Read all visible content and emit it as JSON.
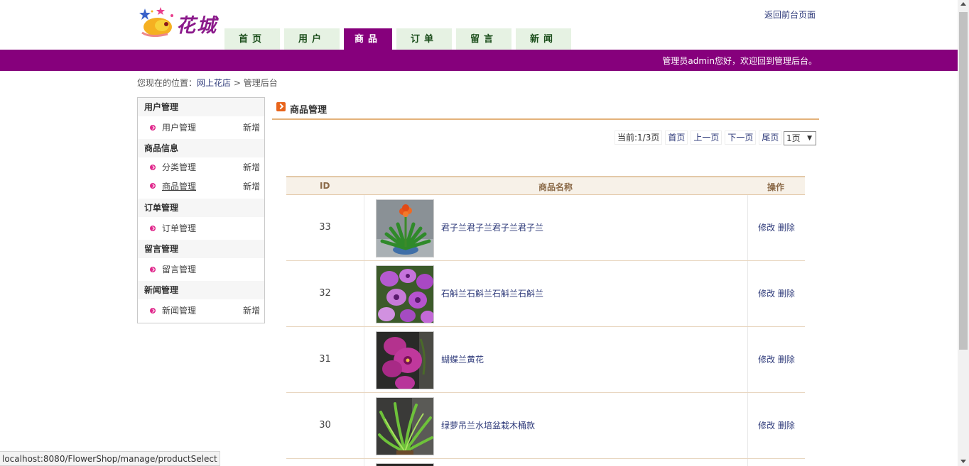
{
  "header": {
    "logo_text": "花城",
    "return_link": "返回前台页面",
    "nav": [
      {
        "label": "首页",
        "active": false
      },
      {
        "label": "用户",
        "active": false
      },
      {
        "label": "商品",
        "active": true
      },
      {
        "label": "订单",
        "active": false
      },
      {
        "label": "留言",
        "active": false
      },
      {
        "label": "新闻",
        "active": false
      }
    ],
    "welcome": "管理员admin您好，欢迎回到管理后台。"
  },
  "breadcrumb": {
    "prefix": "您现在的位置：",
    "link": "网上花店",
    "separator": ">",
    "current": "管理后台"
  },
  "sidebar": {
    "groups": [
      {
        "title": "用户管理",
        "items": [
          {
            "label": "用户管理",
            "add": "新增"
          }
        ]
      },
      {
        "title": "商品信息",
        "items": [
          {
            "label": "分类管理",
            "add": "新增"
          },
          {
            "label": "商品管理",
            "add": "新增"
          }
        ]
      },
      {
        "title": "订单管理",
        "items": [
          {
            "label": "订单管理",
            "add": ""
          }
        ]
      },
      {
        "title": "留言管理",
        "items": [
          {
            "label": "留言管理",
            "add": ""
          }
        ]
      },
      {
        "title": "新闻管理",
        "items": [
          {
            "label": "新闻管理",
            "add": "新增"
          }
        ]
      }
    ]
  },
  "main": {
    "section_title": "商品管理",
    "pager": {
      "current": "当前:1/3页",
      "first": "首页",
      "prev": "上一页",
      "next": "下一页",
      "last": "尾页",
      "selected": "1页"
    },
    "table": {
      "headers": {
        "id": "ID",
        "name": "商品名称",
        "ops": "操作"
      },
      "rows": [
        {
          "id": "33",
          "name": "君子兰君子兰君子兰君子兰",
          "edit": "修改",
          "delete": "删除"
        },
        {
          "id": "32",
          "name": "石斛兰石斛兰石斛兰石斛兰",
          "edit": "修改",
          "delete": "删除"
        },
        {
          "id": "31",
          "name": "蝴蝶兰黄花",
          "edit": "修改",
          "delete": "删除"
        },
        {
          "id": "30",
          "name": "绿萝吊兰水培盆栽木桶款",
          "edit": "修改",
          "delete": "删除"
        }
      ]
    }
  },
  "status_bar": {
    "url": "localhost:8080/FlowerShop/manage/productSelect"
  },
  "colors": {
    "brand_purple": "#86007c",
    "link_blue": "#2e3a7a",
    "tab_green": "#e6f2e3",
    "accent_orange": "#e3b27a"
  }
}
